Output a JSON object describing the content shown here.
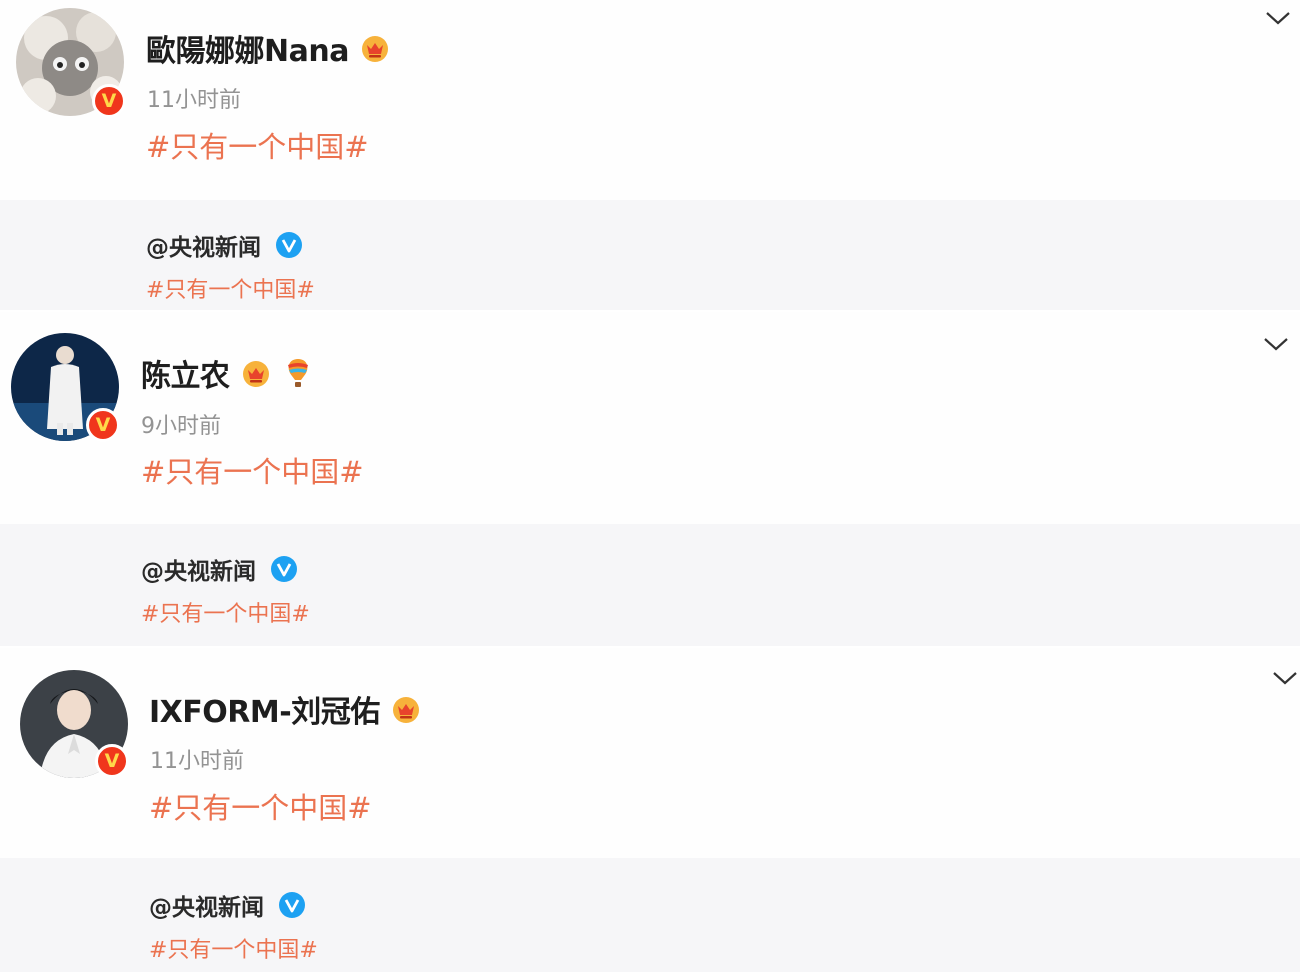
{
  "posts": [
    {
      "author": "歐陽娜娜Nana",
      "time": "11小时前",
      "topic": "#只有一个中国#",
      "badges": [
        "fan-crown-icon"
      ],
      "repost": {
        "user": "@央视新闻",
        "topic": "#只有一个中国#"
      }
    },
    {
      "author": "陈立农",
      "time": "9小时前",
      "topic": "#只有一个中国#",
      "badges": [
        "fan-crown-icon",
        "hot-air-balloon-icon"
      ],
      "repost": {
        "user": "@央视新闻",
        "topic": "#只有一个中国#"
      }
    },
    {
      "author": "IXFORM-刘冠佑",
      "time": "11小时前",
      "topic": "#只有一个中国#",
      "badges": [
        "fan-crown-icon"
      ],
      "repost": {
        "user": "@央视新闻",
        "topic": "#只有一个中国#"
      }
    }
  ],
  "colors": {
    "topic": "#eb7350",
    "verified_red": "#f0361c",
    "verified_blue": "#1da1f2",
    "repost_bg": "#f6f6f8",
    "time": "#939393"
  },
  "verified_badge_letter": "V"
}
